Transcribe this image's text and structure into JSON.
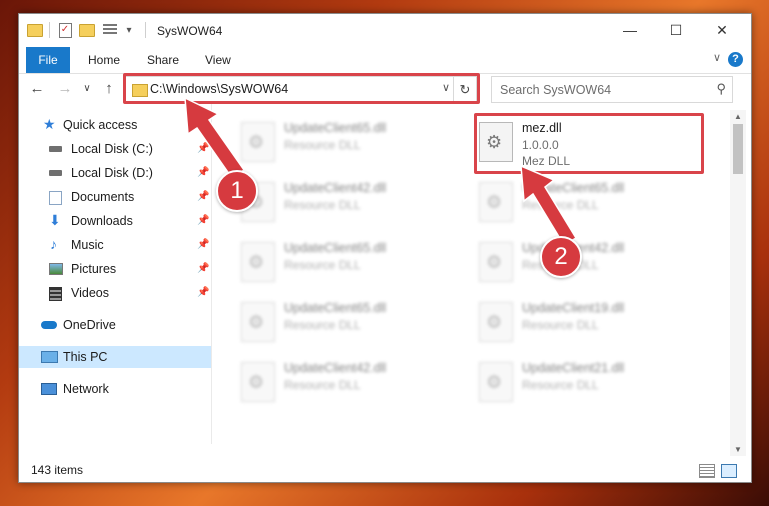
{
  "window": {
    "title": "SysWOW64",
    "controls": {
      "minimize": "—",
      "maximize": "☐",
      "close": "✕"
    }
  },
  "ribbon": {
    "tabs": [
      "File",
      "Home",
      "Share",
      "View"
    ],
    "help": "?",
    "collapse": "∨"
  },
  "nav": {
    "back": "←",
    "forward": "→",
    "recent": "∨",
    "up": "↑",
    "address": "C:\\Windows\\SysWOW64",
    "address_dropdown": "∨",
    "refresh": "↻",
    "search_placeholder": "Search SysWOW64",
    "search_icon": "⚲"
  },
  "sidebar": {
    "items": [
      {
        "label": "Quick access",
        "icon": "star-icon",
        "pinned": false
      },
      {
        "label": "Local Disk (C:)",
        "icon": "drive-icon",
        "pinned": true
      },
      {
        "label": "Local Disk (D:)",
        "icon": "drive-icon",
        "pinned": true
      },
      {
        "label": "Documents",
        "icon": "documents-icon",
        "pinned": true
      },
      {
        "label": "Downloads",
        "icon": "download-icon",
        "pinned": true
      },
      {
        "label": "Music",
        "icon": "music-icon",
        "pinned": true
      },
      {
        "label": "Pictures",
        "icon": "pictures-icon",
        "pinned": true
      },
      {
        "label": "Videos",
        "icon": "videos-icon",
        "pinned": true
      },
      {
        "label": "OneDrive",
        "icon": "cloud-icon",
        "pinned": false
      },
      {
        "label": "This PC",
        "icon": "computer-icon",
        "pinned": false,
        "selected": true
      },
      {
        "label": "Network",
        "icon": "network-icon",
        "pinned": false
      }
    ],
    "pin_glyph": "📌"
  },
  "files": {
    "highlighted": {
      "name": "mez.dll",
      "version": "1.0.0.0",
      "description": "Mez DLL"
    },
    "left_column": [
      {
        "name": "UpdateClient65.dll",
        "type": "Resource DLL"
      },
      {
        "name": "UpdateClient42.dll",
        "type": "Resource DLL"
      },
      {
        "name": "UpdateClient65.dll",
        "type": "Resource DLL"
      },
      {
        "name": "UpdateClient65.dll",
        "type": "Resource DLL"
      },
      {
        "name": "UpdateClient42.dll",
        "type": "Resource DLL"
      }
    ],
    "right_column": [
      {
        "name": "UpdateClient65.dll",
        "type": "Resource DLL"
      },
      {
        "name": "UpdateClient42.dll",
        "type": "Resource DLL"
      },
      {
        "name": "UpdateClient19.dll",
        "type": "Resource DLL"
      },
      {
        "name": "UpdateClient21.dll",
        "type": "Resource DLL"
      }
    ],
    "gear_glyph": "⚙"
  },
  "status": {
    "item_count": "143 items"
  },
  "annotations": {
    "step1": "1",
    "step2": "2",
    "color": "#d63a3f"
  }
}
